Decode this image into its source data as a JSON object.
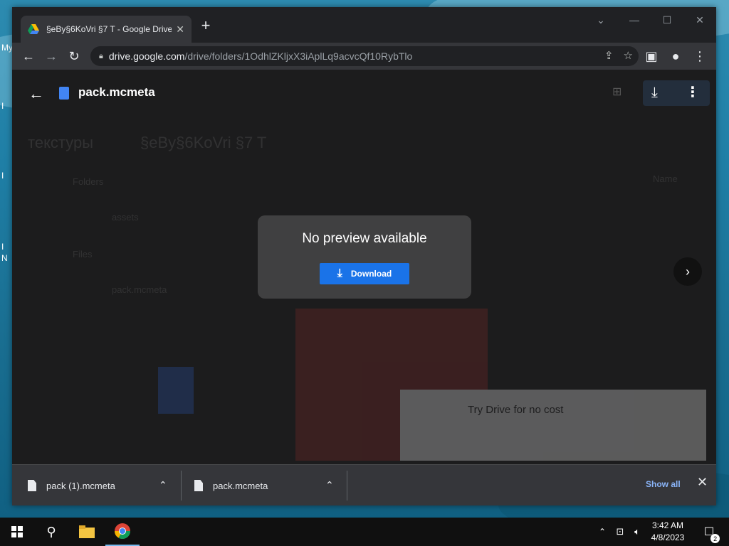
{
  "desktop": {
    "labels": [
      "My",
      "I",
      "I",
      "I",
      "N"
    ]
  },
  "browser": {
    "tab_title": "§eBy§6KoVri §7 T - Google Drive",
    "url_host": "drive.google.com",
    "url_path": "/drive/folders/1OdhlZKljxX3iAplLq9acvcQf10RybTlo"
  },
  "viewer": {
    "file_name": "pack.mcmeta",
    "bg_breadcrumb_root": "текстуры",
    "bg_breadcrumb_current": "§eBy§6KoVri §7 T",
    "bg_folders_label": "Folders",
    "bg_files_label": "Files",
    "bg_folder_name": "assets",
    "bg_file_name": "pack.mcmeta",
    "bg_sort_label": "Name",
    "bg_promo_title": "Try Drive for no cost",
    "no_preview": "No preview available",
    "download_label": "Download"
  },
  "downloads": {
    "items": [
      {
        "name": "pack (1).mcmeta"
      },
      {
        "name": "pack.mcmeta"
      }
    ],
    "show_all": "Show all"
  },
  "taskbar": {
    "time": "3:42 AM",
    "date": "4/8/2023",
    "notification_count": "2"
  },
  "colors": {
    "accent": "#1a73e8",
    "link": "#8ab4f8"
  }
}
